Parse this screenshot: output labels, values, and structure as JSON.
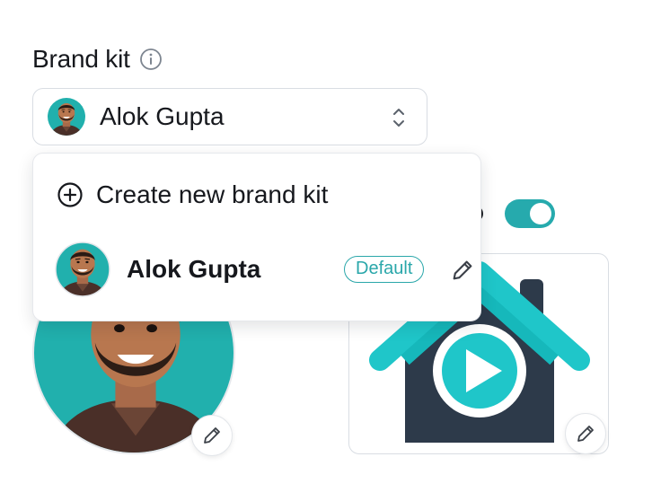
{
  "field": {
    "label": "Brand kit",
    "info_icon": "info-circle-icon"
  },
  "select": {
    "value": "Alok Gupta",
    "icon": "chevron-up-down-icon"
  },
  "menu": {
    "create_label": "Create new brand kit",
    "create_icon": "plus-circle-icon",
    "items": [
      {
        "name": "Alok Gupta",
        "badge": "Default",
        "edit_icon": "pencil-icon"
      }
    ]
  },
  "colors": {
    "accent": "#26aaad",
    "text": "#16181d",
    "border": "#d9dde3",
    "logo_dark": "#2d3a4a",
    "logo_teal": "#1fc6c9"
  }
}
